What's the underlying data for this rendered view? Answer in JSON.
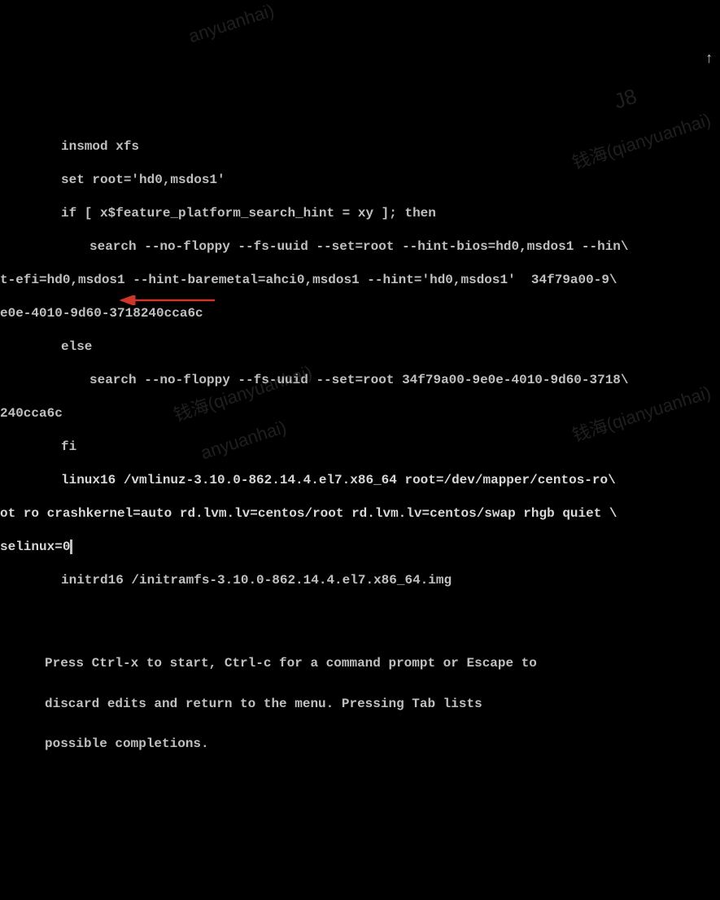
{
  "boot": {
    "lines": {
      "l1": "insmod xfs",
      "l2": "set root='hd0,msdos1'",
      "l3": "if [ x$feature_platform_search_hint = xy ]; then",
      "l4": "search --no-floppy --fs-uuid --set=root --hint-bios=hd0,msdos1 --hin\\",
      "l5": "t-efi=hd0,msdos1 --hint-baremetal=ahci0,msdos1 --hint='hd0,msdos1'  34f79a00-9\\",
      "l6": "e0e-4010-9d60-3718240cca6c",
      "l7": "else",
      "l8": "search --no-floppy --fs-uuid --set=root 34f79a00-9e0e-4010-9d60-3718\\",
      "l9": "240cca6c",
      "l10": "fi",
      "l11": "linux16 /vmlinuz-3.10.0-862.14.4.el7.x86_64 root=/dev/mapper/centos-ro\\",
      "l12": "ot ro crashkernel=auto rd.lvm.lv=centos/root rd.lvm.lv=centos/swap rhgb quiet \\",
      "l13": "selinux=0",
      "l14": "initrd16 /initramfs-3.10.0-862.14.4.el7.x86_64.img"
    },
    "help": {
      "h1": "Press Ctrl-x to start, Ctrl-c for a command prompt or Escape to",
      "h2": "discard edits and return to the menu. Pressing Tab lists",
      "h3": "possible completions."
    }
  },
  "watermark": {
    "text_full": "钱海(qianyuanhai)",
    "text_partial": "anyuanhai)",
    "text_j8": "J8"
  },
  "scroll_indicator": "↑"
}
